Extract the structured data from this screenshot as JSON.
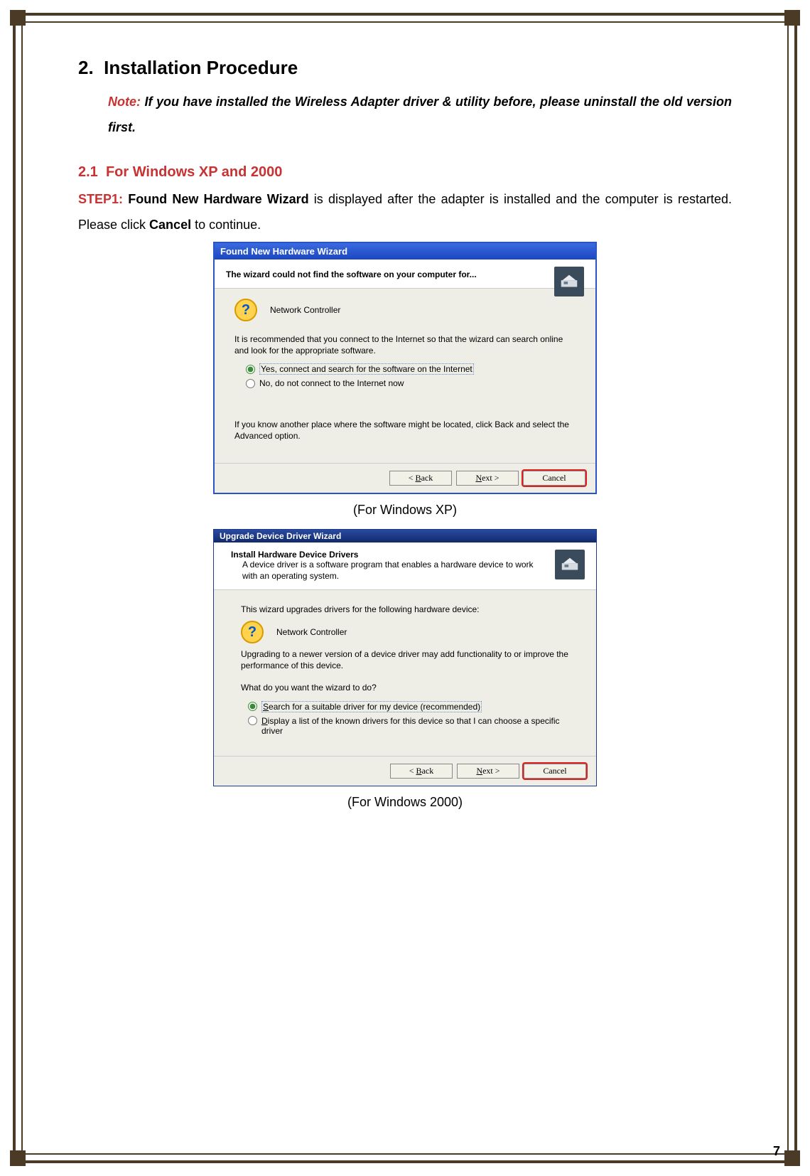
{
  "page_number": "7",
  "headings": {
    "section_num": "2.",
    "section_title": "Installation Procedure",
    "subsection_num": "2.1",
    "subsection_title": "For Windows XP and 2000"
  },
  "note": {
    "label": "Note:",
    "text": " If you have installed the Wireless Adapter driver & utility before, please uninstall the old version first."
  },
  "step1": {
    "label": "STEP1: ",
    "bold1": "Found New Hardware Wizard",
    "text1": " is displayed after the adapter is installed and the computer is restarted. Please click ",
    "bold2": "Cancel",
    "text2": " to continue."
  },
  "wizard_xp": {
    "title": "Found New Hardware Wizard",
    "header": "The wizard could not find the software on your computer for...",
    "device": "Network Controller",
    "recommend": "It is recommended that you connect to the Internet so that the wizard can search online and look for the appropriate software.",
    "radio_yes": "Yes, connect and search for the software on the Internet",
    "radio_no": "No, do not connect to the Internet now",
    "hint": "If you know another place where the software might be located, click Back and select the Advanced option."
  },
  "wizard_2k": {
    "title": "Upgrade Device Driver Wizard",
    "header_title": "Install Hardware Device Drivers",
    "header_sub": "A device driver is a software program that enables a hardware device to work with an operating system.",
    "intro": "This wizard upgrades drivers for the following hardware device:",
    "device": "Network Controller",
    "upgrade": "Upgrading to a newer version of a device driver may add functionality to or improve the performance of this device.",
    "question": "What do you want the wizard to do?",
    "radio_search_suffix": "earch for a suitable driver for my device (recommended)",
    "radio_display_suffix": "isplay a list of the known drivers for this device so that I can choose a specific driver"
  },
  "buttons": {
    "back_suffix": "ack",
    "next_suffix": "ext",
    "cancel": "Cancel"
  },
  "captions": {
    "xp": "(For Windows XP)",
    "w2k": "(For Windows 2000)"
  }
}
